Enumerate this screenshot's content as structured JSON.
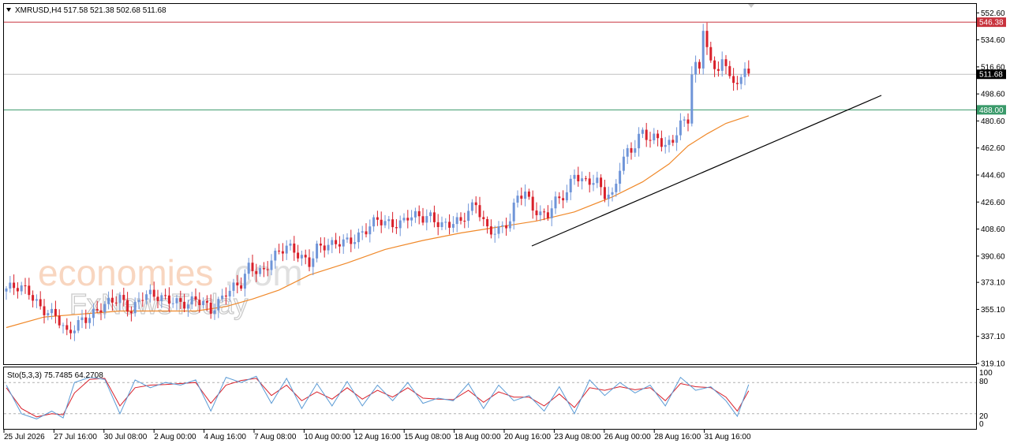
{
  "header": {
    "symbol_line": "XMRUSD,H4  517.58 521.38 502.68 511.68"
  },
  "watermark": {
    "brand": "economies",
    "brand_suffix": ".com",
    "sub": "FxNewsToday"
  },
  "colors": {
    "bull": "#6f95d8",
    "bear": "#d9202a",
    "ma": "#f0892a",
    "resistance": "#c8323c",
    "support": "#3a9a6a",
    "current": "#bfbfbf",
    "trendline": "#000000",
    "stoch_main": "#5b9bd5",
    "stoch_signal": "#d9202a"
  },
  "indicator": {
    "label": "Sto(5,3,3) 75.7485 64.2708",
    "levels_labels": [
      "100",
      "80",
      "20",
      "0"
    ]
  },
  "price_labels": {
    "resistance": "546.38",
    "current": "511.68",
    "support": "488.00"
  },
  "chart_data": {
    "type": "candlestick",
    "symbol": "XMRUSD",
    "timeframe": "H4",
    "ylim": [
      319.1,
      558.0
    ],
    "y_ticks": [
      "552.60",
      "534.60",
      "516.60",
      "498.60",
      "480.60",
      "462.60",
      "444.60",
      "426.60",
      "408.60",
      "390.60",
      "373.10",
      "355.10",
      "337.10",
      "319.10"
    ],
    "x_ticks": [
      "25 Jul 2026",
      "27 Jul 16:00",
      "30 Jul 08:00",
      "2 Aug 00:00",
      "4 Aug 16:00",
      "7 Aug 08:00",
      "10 Aug 00:00",
      "12 Aug 16:00",
      "15 Aug 08:00",
      "18 Aug 00:00",
      "20 Aug 16:00",
      "23 Aug 08:00",
      "26 Aug 00:00",
      "28 Aug 16:00",
      "31 Aug 16:00"
    ],
    "horizontal_lines": [
      {
        "name": "resistance",
        "value": 546.38
      },
      {
        "name": "current",
        "value": 511.68
      },
      {
        "name": "support",
        "value": 488.0
      }
    ],
    "trendline": {
      "from_bar": 2,
      "to_bar": 150,
      "note": "ascending support trendline"
    },
    "close_path": [
      [
        0,
        369
      ],
      [
        6,
        367
      ],
      [
        9,
        358
      ],
      [
        13,
        350
      ],
      [
        16,
        337
      ],
      [
        20,
        350
      ],
      [
        26,
        356
      ],
      [
        30,
        363
      ],
      [
        33,
        356
      ],
      [
        36,
        364
      ],
      [
        40,
        362
      ],
      [
        44,
        363
      ],
      [
        48,
        358
      ],
      [
        50,
        360
      ],
      [
        52,
        358
      ],
      [
        54,
        355
      ],
      [
        58,
        368
      ],
      [
        62,
        370
      ],
      [
        64,
        382
      ],
      [
        68,
        382
      ],
      [
        70,
        390
      ],
      [
        74,
        395
      ],
      [
        76,
        393
      ],
      [
        80,
        388
      ],
      [
        82,
        397
      ],
      [
        86,
        396
      ],
      [
        88,
        399
      ],
      [
        92,
        404
      ],
      [
        95,
        408
      ],
      [
        98,
        413
      ],
      [
        100,
        412
      ],
      [
        104,
        414
      ],
      [
        106,
        418
      ],
      [
        110,
        414
      ],
      [
        112,
        416
      ],
      [
        115,
        413
      ],
      [
        118,
        414
      ],
      [
        120,
        412
      ],
      [
        124,
        425
      ],
      [
        127,
        410
      ],
      [
        130,
        408
      ],
      [
        133,
        412
      ],
      [
        135,
        430
      ],
      [
        137,
        433
      ],
      [
        139,
        425
      ],
      [
        141,
        419
      ],
      [
        143,
        418
      ],
      [
        145,
        425
      ],
      [
        148,
        432
      ],
      [
        150,
        448
      ],
      [
        152,
        442
      ],
      [
        154,
        441
      ],
      [
        156,
        438
      ],
      [
        158,
        430
      ],
      [
        160,
        430
      ],
      [
        162,
        452
      ],
      [
        164,
        462
      ],
      [
        166,
        464
      ],
      [
        168,
        472
      ],
      [
        170,
        466
      ],
      [
        172,
        470
      ],
      [
        174,
        465
      ],
      [
        176,
        470
      ],
      [
        178,
        478
      ],
      [
        180,
        480
      ],
      [
        181,
        510
      ],
      [
        182,
        515
      ],
      [
        183,
        515
      ],
      [
        184,
        544
      ],
      [
        185,
        530
      ],
      [
        186,
        520
      ],
      [
        187,
        519
      ],
      [
        188,
        518
      ],
      [
        189,
        520
      ],
      [
        190,
        515
      ],
      [
        191,
        512
      ],
      [
        192,
        505
      ],
      [
        193,
        500
      ],
      [
        194,
        508
      ],
      [
        195,
        518
      ],
      [
        196,
        512
      ]
    ],
    "ma_path": [
      [
        0,
        343
      ],
      [
        10,
        350
      ],
      [
        20,
        352
      ],
      [
        30,
        354
      ],
      [
        40,
        354
      ],
      [
        50,
        354
      ],
      [
        58,
        357
      ],
      [
        65,
        362
      ],
      [
        72,
        368
      ],
      [
        80,
        378
      ],
      [
        90,
        386
      ],
      [
        100,
        395
      ],
      [
        110,
        401
      ],
      [
        120,
        406
      ],
      [
        130,
        410
      ],
      [
        140,
        414
      ],
      [
        150,
        420
      ],
      [
        160,
        430
      ],
      [
        168,
        440
      ],
      [
        175,
        452
      ],
      [
        180,
        464
      ],
      [
        185,
        472
      ],
      [
        190,
        479
      ],
      [
        196,
        484
      ]
    ],
    "stochastic": {
      "params": "5,3,3",
      "k_last": 75.7485,
      "d_last": 64.2708,
      "levels": [
        20,
        80
      ],
      "k_path": [
        [
          0,
          75
        ],
        [
          4,
          20
        ],
        [
          8,
          10
        ],
        [
          12,
          25
        ],
        [
          15,
          12
        ],
        [
          18,
          80
        ],
        [
          22,
          90
        ],
        [
          26,
          86
        ],
        [
          30,
          20
        ],
        [
          34,
          85
        ],
        [
          38,
          70
        ],
        [
          42,
          80
        ],
        [
          46,
          75
        ],
        [
          50,
          85
        ],
        [
          54,
          25
        ],
        [
          58,
          90
        ],
        [
          62,
          80
        ],
        [
          66,
          92
        ],
        [
          70,
          40
        ],
        [
          74,
          88
        ],
        [
          78,
          30
        ],
        [
          82,
          78
        ],
        [
          86,
          35
        ],
        [
          90,
          82
        ],
        [
          94,
          35
        ],
        [
          98,
          75
        ],
        [
          102,
          45
        ],
        [
          106,
          80
        ],
        [
          110,
          40
        ],
        [
          114,
          50
        ],
        [
          118,
          45
        ],
        [
          122,
          78
        ],
        [
          126,
          30
        ],
        [
          130,
          75
        ],
        [
          134,
          45
        ],
        [
          138,
          55
        ],
        [
          142,
          25
        ],
        [
          146,
          72
        ],
        [
          150,
          20
        ],
        [
          154,
          85
        ],
        [
          158,
          55
        ],
        [
          162,
          80
        ],
        [
          166,
          60
        ],
        [
          170,
          75
        ],
        [
          174,
          35
        ],
        [
          178,
          90
        ],
        [
          182,
          65
        ],
        [
          186,
          72
        ],
        [
          190,
          45
        ],
        [
          193,
          15
        ],
        [
          196,
          76
        ]
      ],
      "d_path": [
        [
          0,
          70
        ],
        [
          4,
          30
        ],
        [
          8,
          14
        ],
        [
          12,
          20
        ],
        [
          15,
          18
        ],
        [
          18,
          60
        ],
        [
          22,
          86
        ],
        [
          26,
          88
        ],
        [
          30,
          35
        ],
        [
          34,
          70
        ],
        [
          38,
          75
        ],
        [
          42,
          76
        ],
        [
          46,
          78
        ],
        [
          50,
          80
        ],
        [
          54,
          40
        ],
        [
          58,
          75
        ],
        [
          62,
          84
        ],
        [
          66,
          88
        ],
        [
          70,
          55
        ],
        [
          74,
          75
        ],
        [
          78,
          45
        ],
        [
          82,
          62
        ],
        [
          86,
          48
        ],
        [
          90,
          70
        ],
        [
          94,
          48
        ],
        [
          98,
          65
        ],
        [
          102,
          52
        ],
        [
          106,
          70
        ],
        [
          110,
          50
        ],
        [
          114,
          48
        ],
        [
          118,
          47
        ],
        [
          122,
          65
        ],
        [
          126,
          42
        ],
        [
          130,
          62
        ],
        [
          134,
          52
        ],
        [
          138,
          52
        ],
        [
          142,
          35
        ],
        [
          146,
          58
        ],
        [
          150,
          32
        ],
        [
          154,
          70
        ],
        [
          158,
          65
        ],
        [
          162,
          72
        ],
        [
          166,
          66
        ],
        [
          170,
          70
        ],
        [
          174,
          45
        ],
        [
          178,
          78
        ],
        [
          182,
          72
        ],
        [
          186,
          70
        ],
        [
          190,
          52
        ],
        [
          193,
          25
        ],
        [
          196,
          64
        ]
      ]
    }
  }
}
